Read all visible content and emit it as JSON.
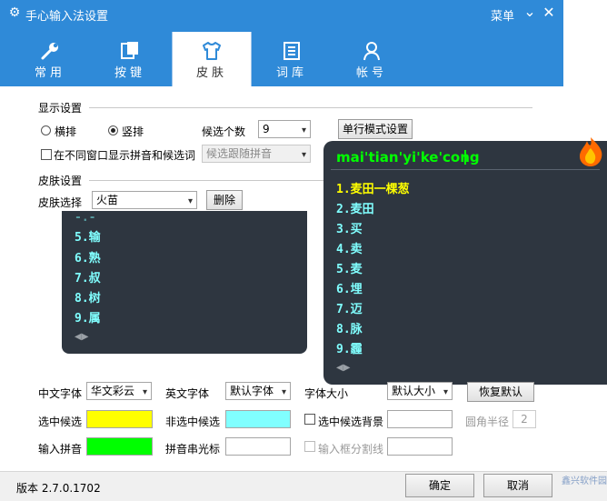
{
  "window": {
    "title": "手心输入法设置",
    "menu_label": "菜单",
    "minimize_glyph": "⌄",
    "close_glyph": "✕"
  },
  "tabs": [
    {
      "label": "常用",
      "icon": "wrench-icon"
    },
    {
      "label": "按键",
      "icon": "keys-icon"
    },
    {
      "label": "皮肤",
      "icon": "shirt-icon",
      "active": true
    },
    {
      "label": "词库",
      "icon": "book-icon"
    },
    {
      "label": "帐号",
      "icon": "person-icon"
    }
  ],
  "display": {
    "header": "显示设置",
    "horizontal": "横排",
    "vertical": "竖排",
    "orientation_selected": "竖排",
    "cand_count_label": "候选个数",
    "cand_count_value": "9",
    "single_mode_button": "单行模式设置",
    "separate_window_label": "在不同窗口显示拼音和候选词",
    "separate_window_checked": false,
    "follow_pinyin_value": "候选跟随拼音"
  },
  "skin": {
    "header": "皮肤设置",
    "select_label": "皮肤选择",
    "select_value": "火苗",
    "delete_button": "删除"
  },
  "preview_small": {
    "candidates": [
      "5.输",
      "6.熟",
      "7.叔",
      "8.树",
      "9.属"
    ]
  },
  "preview_large": {
    "input": "mai'tian'yi'ke'cong",
    "candidates": [
      "1.麦田一棵葱",
      "2.麦田",
      "3.买",
      "4.卖",
      "5.麦",
      "6.埋",
      "7.迈",
      "8.脉",
      "9.霾"
    ]
  },
  "fonts": {
    "cn_label": "中文字体",
    "cn_value": "华文彩云",
    "en_label": "英文字体",
    "en_value": "默认字体",
    "size_label": "字体大小",
    "size_value": "默认大小",
    "restore_button": "恢复默认"
  },
  "colors": {
    "selected_label": "选中候选",
    "selected_color": "#ffff00",
    "unselected_label": "非选中候选",
    "unselected_color": "#80ffff",
    "selected_bg_label": "选中候选背景",
    "radius_label": "圆角半径",
    "radius_value": "2",
    "input_pinyin_label": "输入拼音",
    "input_pinyin_color": "#00ff00",
    "cursor_label": "拼音串光标",
    "divider_label": "输入框分割线"
  },
  "footer": {
    "version": "版本 2.7.0.1702",
    "ok_button": "确定",
    "cancel_button": "取消",
    "watermark": "鑫兴软件园"
  },
  "theme": {
    "titlebar": "#2f8ad8",
    "dark_panel": "#2e3640",
    "cand_first": "#ffff00",
    "cand_other": "#80ffff",
    "input_color": "#00ff00"
  }
}
